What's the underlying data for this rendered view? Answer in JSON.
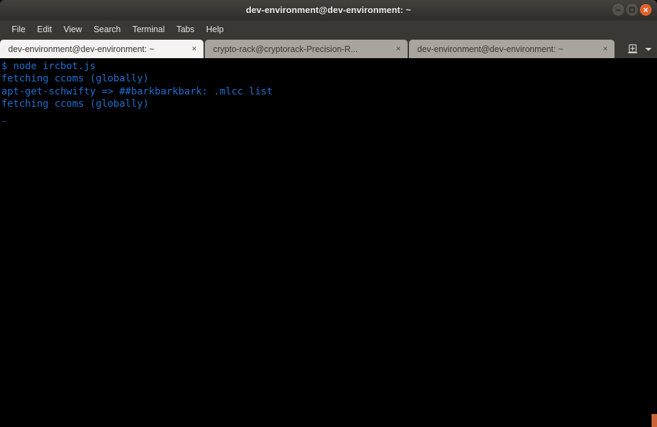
{
  "window": {
    "title": "dev-environment@dev-environment: ~",
    "controls": [
      {
        "name": "minimize",
        "glyph": "minus",
        "color": "#53504b"
      },
      {
        "name": "maximize",
        "glyph": "square",
        "color": "#53504b"
      },
      {
        "name": "close",
        "glyph": "x",
        "color": "#e0602c"
      }
    ]
  },
  "menubar": {
    "items": [
      {
        "label": "File"
      },
      {
        "label": "Edit"
      },
      {
        "label": "View"
      },
      {
        "label": "Search"
      },
      {
        "label": "Terminal"
      },
      {
        "label": "Tabs"
      },
      {
        "label": "Help"
      }
    ]
  },
  "tabbar": {
    "tabs": [
      {
        "label": "dev-environment@dev-environment: ~",
        "close": "×",
        "active": true
      },
      {
        "label": "crypto-rack@cryptorack-Precision-R...",
        "close": "×",
        "active": false
      },
      {
        "label": "dev-environment@dev-environment: ~",
        "close": "×",
        "active": false
      }
    ],
    "new_tab_icon": "new-tab-icon",
    "tab_menu_icon": "chevron-down-icon"
  },
  "terminal": {
    "foreground_color": "#1f6fd0",
    "background_color": "#000000",
    "lines": [
      "$ node ircbot.js",
      "fetching ccoms (globally)",
      "apt-get-schwifty => ##barkbarkbark: .mlcc list",
      "fetching ccoms (globally)",
      ""
    ],
    "cursor": "_"
  },
  "resize_grip": {
    "color": "#cb6434"
  }
}
